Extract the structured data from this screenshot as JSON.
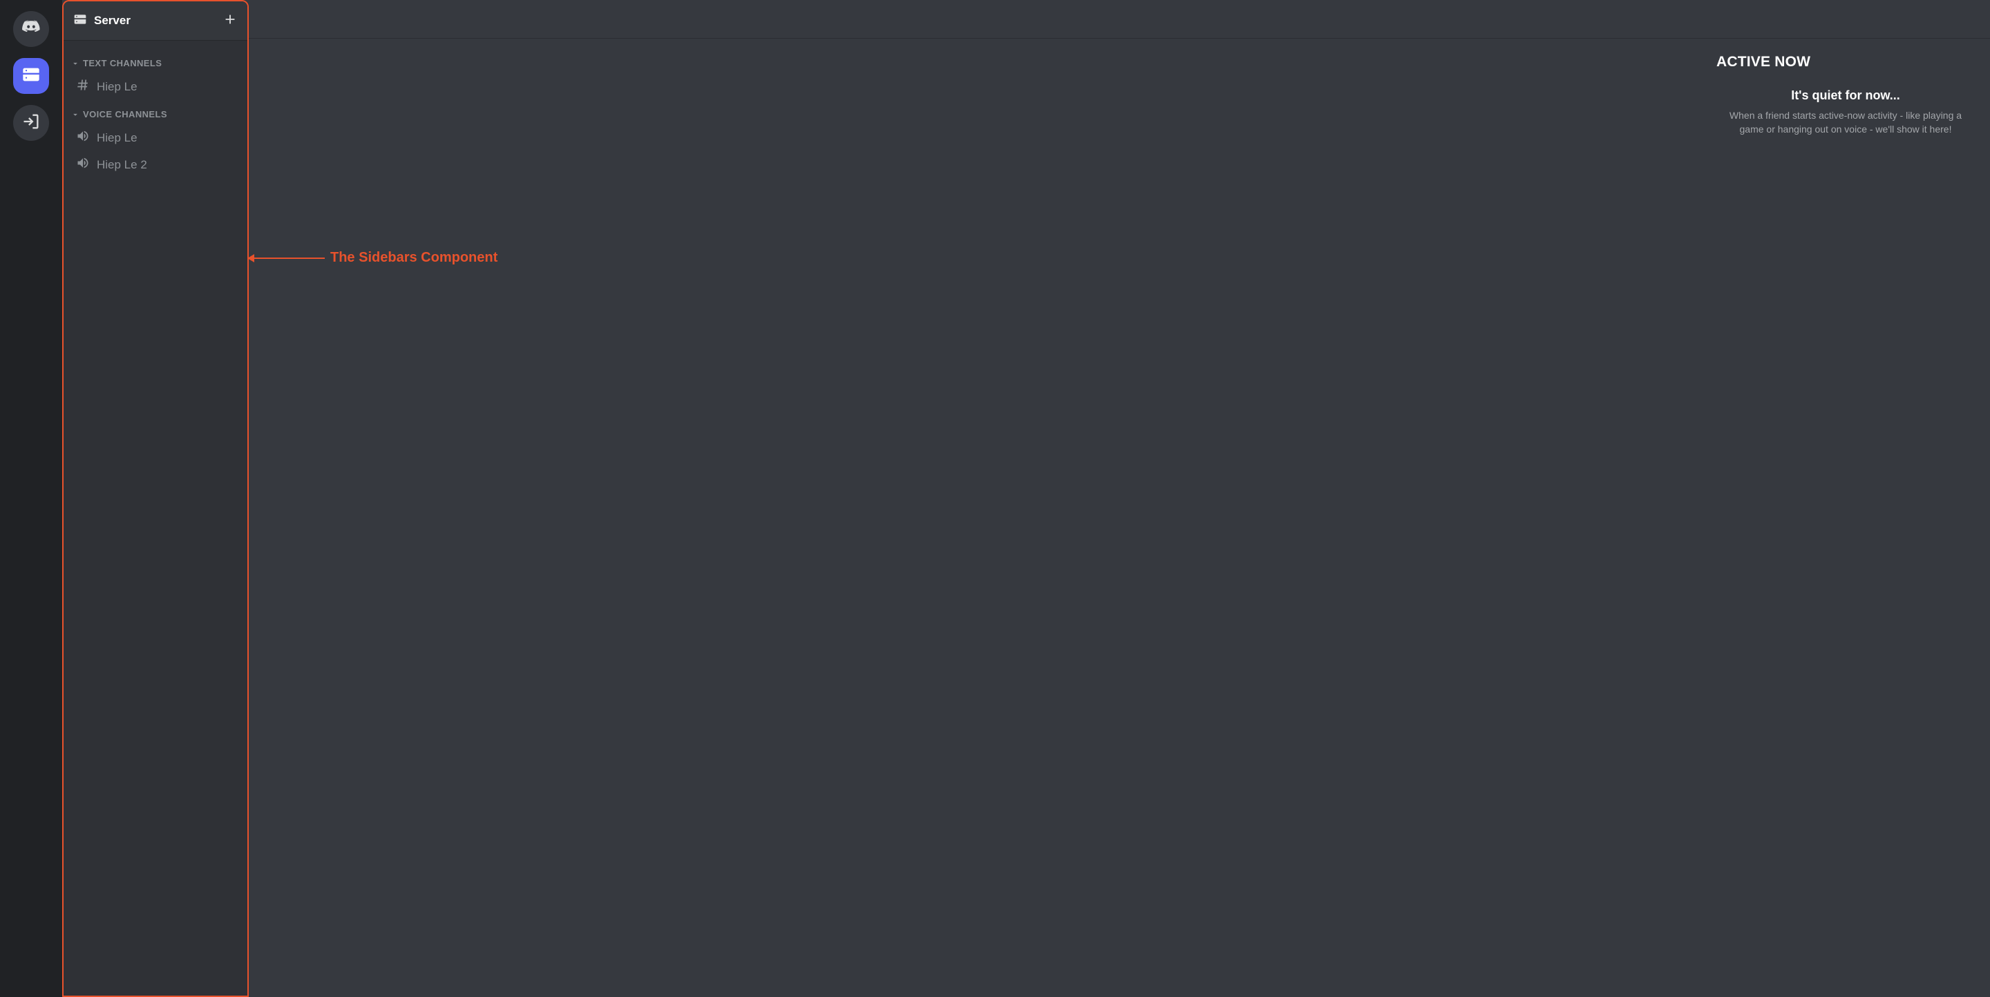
{
  "server_rail": {
    "items": [
      {
        "name": "home-discord",
        "active": false
      },
      {
        "name": "server-drive",
        "active": true
      },
      {
        "name": "logout",
        "active": false
      }
    ]
  },
  "sidebar": {
    "server_name": "Server",
    "categories": [
      {
        "label": "TEXT CHANNELS",
        "channels": [
          {
            "name": "Hiep Le",
            "type": "text"
          }
        ]
      },
      {
        "label": "VOICE CHANNELS",
        "channels": [
          {
            "name": "Hiep Le",
            "type": "voice"
          },
          {
            "name": "Hiep Le 2",
            "type": "voice"
          }
        ]
      }
    ]
  },
  "annotation": {
    "label": "The Sidebars Component"
  },
  "right_panel": {
    "title": "ACTIVE NOW",
    "quiet_title": "It's quiet for now...",
    "quiet_desc": "When a friend starts active-now activity - like playing a game or hanging out on voice - we'll show it here!"
  }
}
